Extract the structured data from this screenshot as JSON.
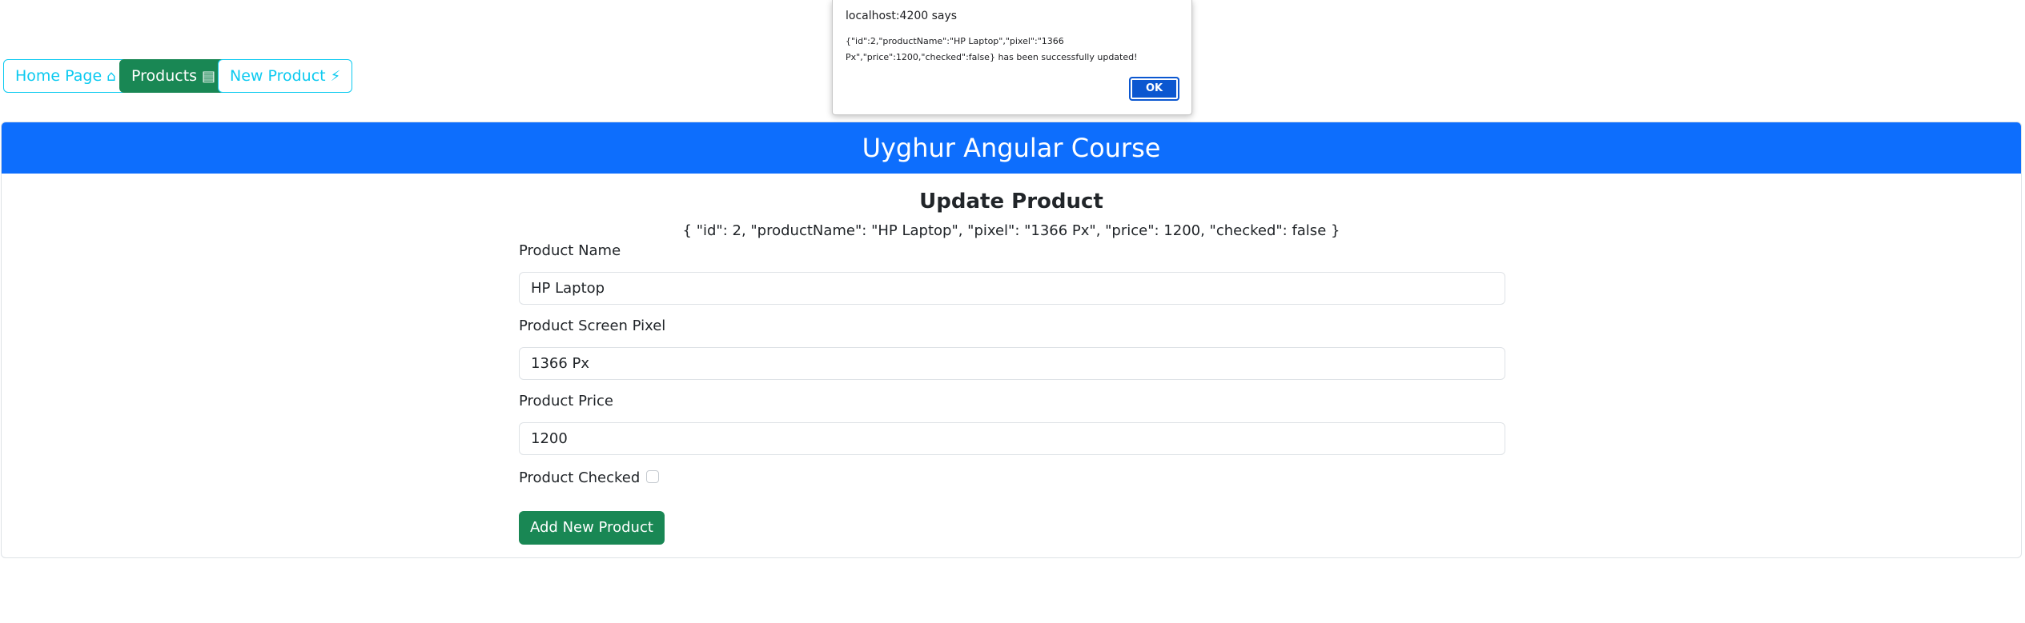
{
  "nav": {
    "home_label": "Home Page",
    "home_icon": "house-icon",
    "products_label": "Products",
    "products_icon": "archive-icon",
    "new_product_label": "New Product",
    "new_product_icon": "magic-wand-icon"
  },
  "alert": {
    "title": "localhost:4200 says",
    "message_line1": "{\"id\":2,\"productName\":\"HP Laptop\",\"pixel\":\"1366",
    "message_line2": "Px\",\"price\":1200,\"checked\":false} has been successfully updated!",
    "ok_label": "OK"
  },
  "card": {
    "header": "Uyghur Angular Course",
    "title": "Update Product",
    "json_text": "{ \"id\": 2, \"productName\": \"HP Laptop\", \"pixel\": \"1366 Px\", \"price\": 1200, \"checked\": false }"
  },
  "form": {
    "name_label": "Product Name",
    "name_value": "HP Laptop",
    "pixel_label": "Product Screen Pixel",
    "pixel_value": "1366 Px",
    "price_label": "Product Price",
    "price_value": "1200",
    "checked_label": "Product Checked",
    "checked": false,
    "submit_label": "Add New Product"
  },
  "colors": {
    "primary": "#0d6efd",
    "success": "#198754",
    "info": "#0dcaf0",
    "dialog_button": "#0b57d0"
  }
}
